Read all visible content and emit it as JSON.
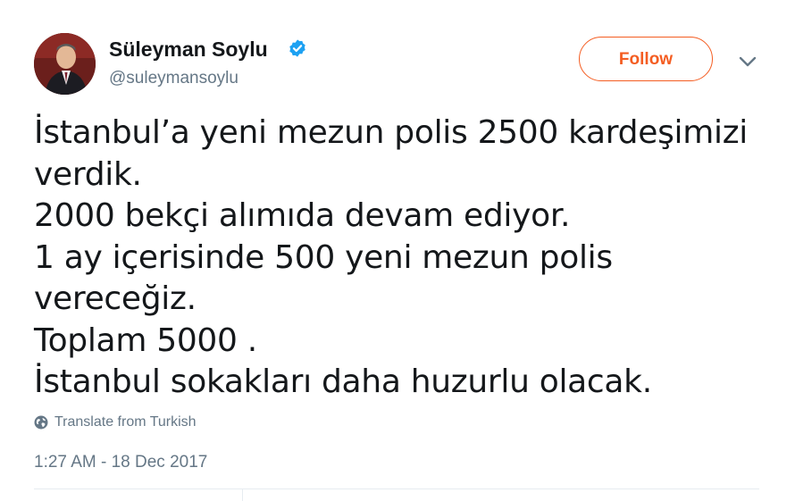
{
  "user": {
    "display_name": "Süleyman Soylu",
    "handle": "@suleymansoylu",
    "verified": true,
    "avatar_icon": "profile-photo"
  },
  "actions": {
    "follow_label": "Follow",
    "menu_icon": "chevron-down-icon"
  },
  "tweet": {
    "lines": [
      "İstanbul’a yeni mezun polis 2500 kardeşimizi",
      "verdik.",
      "2000 bekçi alımıda devam ediyor.",
      "1 ay içerisinde 500 yeni mezun polis",
      "vereceğiz.",
      "Toplam 5000 .",
      "İstanbul sokakları daha huzurlu olacak."
    ],
    "translate_label": "Translate from Turkish",
    "translate_icon": "globe-icon",
    "timestamp": "1:27 AM - 18 Dec 2017"
  },
  "colors": {
    "accent": "#f45d22",
    "verified_blue": "#1da1f2",
    "secondary_text": "#657786",
    "primary_text": "#14171a",
    "divider": "#e6ecf0"
  }
}
